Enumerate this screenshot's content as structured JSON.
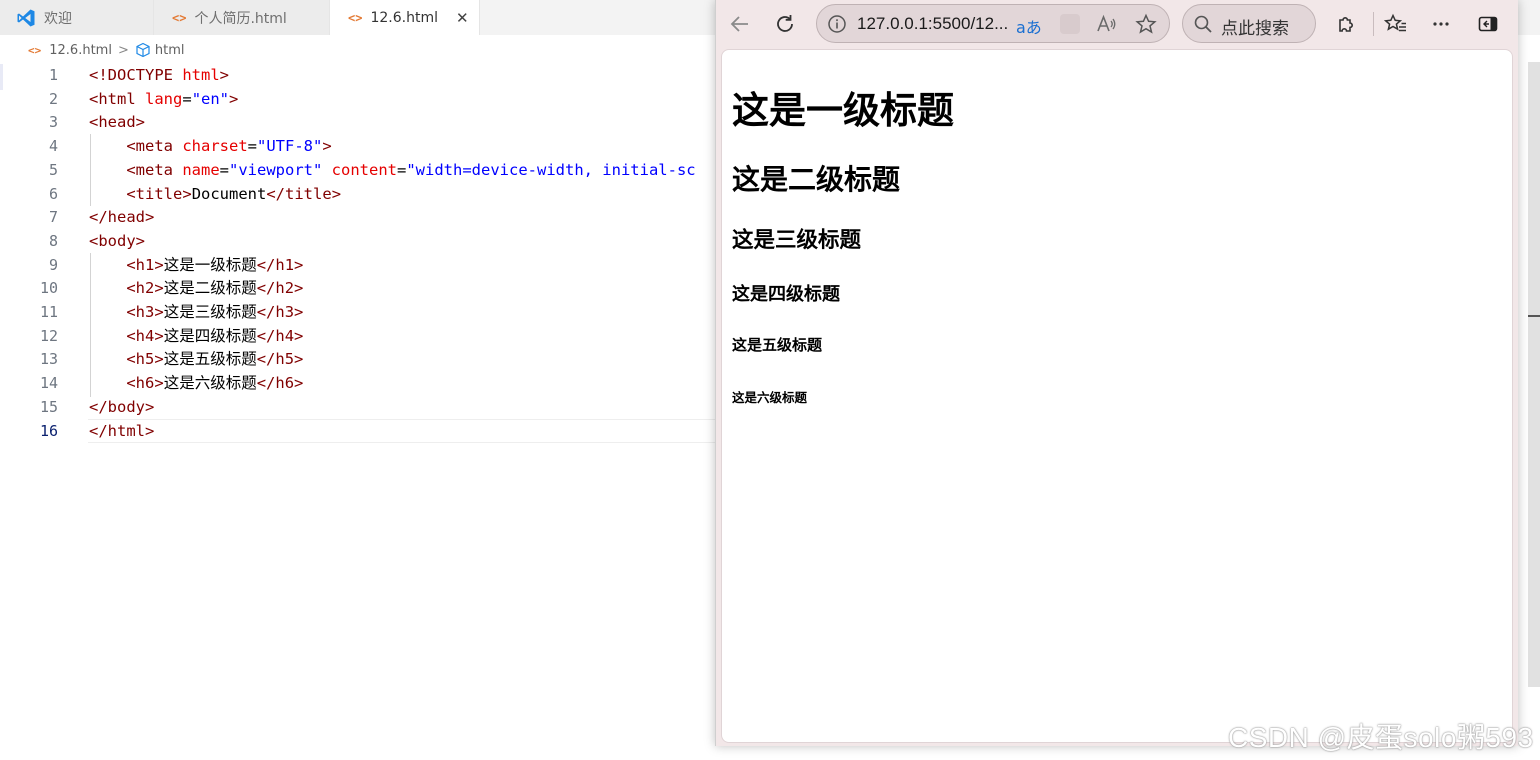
{
  "editor": {
    "tabs": [
      {
        "label": "欢迎",
        "icon": "vscode-logo-icon"
      },
      {
        "label": "个人简历.html",
        "icon": "html-file-icon"
      },
      {
        "label": "12.6.html",
        "icon": "html-file-icon",
        "close": "✕"
      }
    ],
    "breadcrumb": {
      "file": "12.6.html",
      "separator": ">",
      "symbol": "html"
    },
    "lines": [
      {
        "n": "1",
        "tokens": [
          [
            "t-punc",
            "<!"
          ],
          [
            "t-tag",
            "DOCTYPE "
          ],
          [
            "t-attr",
            "html"
          ],
          [
            "t-punc",
            ">"
          ]
        ]
      },
      {
        "n": "2",
        "tokens": [
          [
            "t-punc",
            "<"
          ],
          [
            "t-tag",
            "html "
          ],
          [
            "t-attr",
            "lang"
          ],
          [
            "t-text",
            "="
          ],
          [
            "t-val",
            "\"en\""
          ],
          [
            "t-punc",
            ">"
          ]
        ]
      },
      {
        "n": "3",
        "tokens": [
          [
            "t-punc",
            "<"
          ],
          [
            "t-tag",
            "head"
          ],
          [
            "t-punc",
            ">"
          ]
        ]
      },
      {
        "n": "4",
        "tokens": [
          [
            "t-text",
            "    "
          ],
          [
            "t-punc",
            "<"
          ],
          [
            "t-tag",
            "meta "
          ],
          [
            "t-attr",
            "charset"
          ],
          [
            "t-text",
            "="
          ],
          [
            "t-val",
            "\"UTF-8\""
          ],
          [
            "t-punc",
            ">"
          ]
        ]
      },
      {
        "n": "5",
        "tokens": [
          [
            "t-text",
            "    "
          ],
          [
            "t-punc",
            "<"
          ],
          [
            "t-tag",
            "meta "
          ],
          [
            "t-attr",
            "name"
          ],
          [
            "t-text",
            "="
          ],
          [
            "t-val",
            "\"viewport\" "
          ],
          [
            "t-attr",
            "content"
          ],
          [
            "t-text",
            "="
          ],
          [
            "t-val",
            "\"width=device-width, initial-sc"
          ]
        ]
      },
      {
        "n": "6",
        "tokens": [
          [
            "t-text",
            "    "
          ],
          [
            "t-punc",
            "<"
          ],
          [
            "t-tag",
            "title"
          ],
          [
            "t-punc",
            ">"
          ],
          [
            "t-text",
            "Document"
          ],
          [
            "t-punc",
            "</"
          ],
          [
            "t-tag",
            "title"
          ],
          [
            "t-punc",
            ">"
          ]
        ]
      },
      {
        "n": "7",
        "tokens": [
          [
            "t-punc",
            "</"
          ],
          [
            "t-tag",
            "head"
          ],
          [
            "t-punc",
            ">"
          ]
        ]
      },
      {
        "n": "8",
        "tokens": [
          [
            "t-punc",
            "<"
          ],
          [
            "t-tag",
            "body"
          ],
          [
            "t-punc",
            ">"
          ]
        ]
      },
      {
        "n": "9",
        "tokens": [
          [
            "t-text",
            "    "
          ],
          [
            "t-punc",
            "<"
          ],
          [
            "t-tag",
            "h1"
          ],
          [
            "t-punc",
            ">"
          ],
          [
            "t-text",
            "这是一级标题"
          ],
          [
            "t-punc",
            "</"
          ],
          [
            "t-tag",
            "h1"
          ],
          [
            "t-punc",
            ">"
          ]
        ]
      },
      {
        "n": "10",
        "tokens": [
          [
            "t-text",
            "    "
          ],
          [
            "t-punc",
            "<"
          ],
          [
            "t-tag",
            "h2"
          ],
          [
            "t-punc",
            ">"
          ],
          [
            "t-text",
            "这是二级标题"
          ],
          [
            "t-punc",
            "</"
          ],
          [
            "t-tag",
            "h2"
          ],
          [
            "t-punc",
            ">"
          ]
        ]
      },
      {
        "n": "11",
        "tokens": [
          [
            "t-text",
            "    "
          ],
          [
            "t-punc",
            "<"
          ],
          [
            "t-tag",
            "h3"
          ],
          [
            "t-punc",
            ">"
          ],
          [
            "t-text",
            "这是三级标题"
          ],
          [
            "t-punc",
            "</"
          ],
          [
            "t-tag",
            "h3"
          ],
          [
            "t-punc",
            ">"
          ]
        ]
      },
      {
        "n": "12",
        "tokens": [
          [
            "t-text",
            "    "
          ],
          [
            "t-punc",
            "<"
          ],
          [
            "t-tag",
            "h4"
          ],
          [
            "t-punc",
            ">"
          ],
          [
            "t-text",
            "这是四级标题"
          ],
          [
            "t-punc",
            "</"
          ],
          [
            "t-tag",
            "h4"
          ],
          [
            "t-punc",
            ">"
          ]
        ]
      },
      {
        "n": "13",
        "tokens": [
          [
            "t-text",
            "    "
          ],
          [
            "t-punc",
            "<"
          ],
          [
            "t-tag",
            "h5"
          ],
          [
            "t-punc",
            ">"
          ],
          [
            "t-text",
            "这是五级标题"
          ],
          [
            "t-punc",
            "</"
          ],
          [
            "t-tag",
            "h5"
          ],
          [
            "t-punc",
            ">"
          ]
        ]
      },
      {
        "n": "14",
        "tokens": [
          [
            "t-text",
            "    "
          ],
          [
            "t-punc",
            "<"
          ],
          [
            "t-tag",
            "h6"
          ],
          [
            "t-punc",
            ">"
          ],
          [
            "t-text",
            "这是六级标题"
          ],
          [
            "t-punc",
            "</"
          ],
          [
            "t-tag",
            "h6"
          ],
          [
            "t-punc",
            ">"
          ]
        ]
      },
      {
        "n": "15",
        "tokens": [
          [
            "t-punc",
            "</"
          ],
          [
            "t-tag",
            "body"
          ],
          [
            "t-punc",
            ">"
          ]
        ]
      },
      {
        "n": "16",
        "tokens": [
          [
            "t-punc",
            "</"
          ],
          [
            "t-tag",
            "html"
          ],
          [
            "t-punc",
            ">"
          ]
        ]
      }
    ]
  },
  "browser": {
    "url": "127.0.0.1:5500/12...",
    "translate_label": "aあ",
    "search_placeholder": "点此搜索",
    "page": {
      "h1": "这是一级标题",
      "h2": "这是二级标题",
      "h3": "这是三级标题",
      "h4": "这是四级标题",
      "h5": "这是五级标题",
      "h6": "这是六级标题"
    }
  },
  "watermark": "CSDN @皮蛋solo粥593",
  "colors": {
    "tag": "#800000",
    "attr": "#e50000",
    "value": "#0000ff",
    "html_icon": "#e37933",
    "vscode_blue": "#1e88e5"
  }
}
